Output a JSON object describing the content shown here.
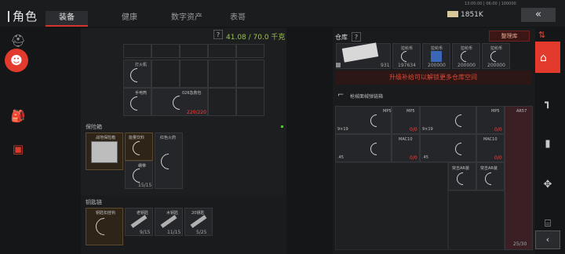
{
  "header": {
    "title": "角色",
    "tabs": [
      {
        "label": "装备",
        "active": true
      },
      {
        "label": "健康",
        "active": false
      },
      {
        "label": "数字资产",
        "active": false
      },
      {
        "label": "表哥",
        "active": false
      }
    ],
    "money": "1851K",
    "tiny_text": "13:00:00 | 06:00 | 100000",
    "back_label": "«"
  },
  "sidebar": {
    "icons": [
      "helmet-icon",
      "character-icon",
      "backpack-icon",
      "chat-icon"
    ]
  },
  "left": {
    "weight": "41.08 / 70.0 千克",
    "question": "?",
    "backpack_slots": [
      {
        "label": "打火机"
      },
      {
        "label": "手电筒"
      },
      {
        "label": "026急救包",
        "count": "220/220"
      }
    ],
    "safe_box": {
      "title": "保险箱",
      "items": [
        {
          "label": "战地保险箱"
        },
        {
          "label": "能量饮料"
        },
        {
          "label": "红色火药"
        },
        {
          "label": "绷带",
          "count": "15/15"
        }
      ]
    },
    "keychain": {
      "title": "钥匙链",
      "items": [
        {
          "label": "钥匙扣挂钩"
        },
        {
          "label": "老钥匙",
          "count": "9/15"
        },
        {
          "label": "木钥匙",
          "count": "11/15"
        },
        {
          "label": "20钥匙",
          "count": "5/25"
        }
      ]
    }
  },
  "right": {
    "title": "仓库",
    "sort_label": "整理库",
    "top_items": [
      {
        "label": "",
        "count": "931"
      },
      {
        "label": "拉纶币",
        "count": "197634"
      },
      {
        "label": "拉纶币",
        "count": "200000"
      },
      {
        "label": "拉纶币",
        "count": "200000"
      },
      {
        "label": "拉纶币",
        "count": "200000"
      }
    ],
    "upgrade": "升级补给可以解锁更多仓库空间",
    "case_title": "枪械面械弹链箱",
    "guns": [
      {
        "caliber": "9×19",
        "name": "MP5"
      },
      {
        "caliber": "9×19",
        "name": "MP5"
      },
      {
        "caliber": ".45",
        "name": "MAC10"
      },
      {
        "caliber": ".45",
        "name": "MAC10"
      }
    ],
    "rifles_labels": [
      "突击AR装",
      "突击AR装"
    ],
    "ar_name": "AR57",
    "ar_count": "25/30",
    "zero": "0/0"
  },
  "colors": {
    "accent": "#e23b2e",
    "weight_green": "#99c24a"
  }
}
